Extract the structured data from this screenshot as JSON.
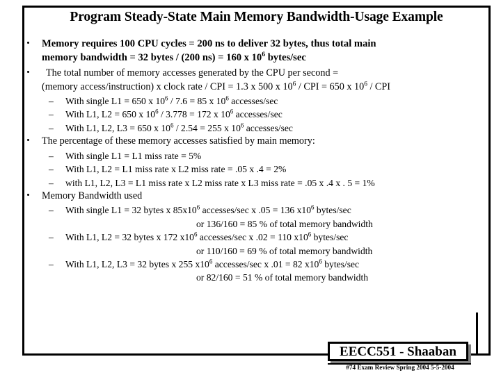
{
  "slide": {
    "title": "Program Steady-State Main Memory Bandwidth-Usage Example",
    "bullets": [
      {
        "id": "memory-requires",
        "line1": "Memory requires 100 CPU cycles =  200 ns  to deliver 32 bytes, thus total main",
        "line2_a": "memory bandwidth  =  32 bytes / (200 ns)   = 160 x 10",
        "line2_sup": "6",
        "line2_b": " bytes/sec"
      },
      {
        "id": "total-accesses",
        "line1": "The total number of memory accesses generated by the CPU per second  =",
        "line2_a": "(memory access/instruction)  x clock rate / CPI  =  1.3 x 500 x 10",
        "line2_sup1": "6",
        "line2_b": " / CPI =  650 x 10",
        "line2_sup2": "6",
        "line2_c": " / CPI",
        "subs": [
          {
            "a": "With single L1   = 650 x 10",
            "s1": "6",
            "b": " / 7.6   =   85 x   10",
            "s2": "6",
            "c": "  accesses/sec"
          },
          {
            "a": "With L1, L2   =   650 x 10",
            "s1": "6",
            "b": " / 3.778 =   172 x   10",
            "s2": "6",
            "c": "  accesses/sec"
          },
          {
            "a": "With L1, L2, L3  = 650 x 10",
            "s1": "6",
            "b": " / 2.54  =   255 x   10",
            "s2": "6",
            "c": "  accesses/sec"
          }
        ]
      },
      {
        "id": "percentage-satisfied",
        "line1": "The percentage of these memory accesses satisfied by main memory:",
        "subs": [
          {
            "a": "With single L1  =  L1 miss rate =  5%"
          },
          {
            "a": "With L1, L2  =  L1 miss rate x L2 miss rate =    .05 x .4  = 2%"
          },
          {
            "a": "with L1, L2, L3  = L1 miss rate x L2 miss rate  x L3 miss rate = .05 x .4 x . 5 = 1%"
          }
        ]
      },
      {
        "id": "bandwidth-used",
        "line1": "Memory Bandwidth used",
        "subs": [
          {
            "a": "With single L1 =  32 bytes  x  85x10",
            "s1": "6",
            "b": "  accesses/sec x .05  =   136 x10",
            "s2": "6",
            "c": "    bytes/sec",
            "cont": "or  136/160  =  85 %  of total memory bandwidth"
          },
          {
            "a": "With  L1, L2 =  32 bytes  x  172 x10",
            "s1": "6",
            "b": "  accesses/sec x .02  =   110 x10",
            "s2": "6",
            "c": "    bytes/sec",
            "cont": "or  110/160  =  69 %  of total memory bandwidth"
          },
          {
            "a": "With  L1, L2, L3  =  32 bytes  x  255 x10",
            "s1": "6",
            "b": "  accesses/sec x .01  =    82 x10",
            "s2": "6",
            "c": "   bytes/sec",
            "cont": "or  82/160  =  51 %  of total memory bandwidth"
          }
        ]
      }
    ],
    "dash_marker": "–",
    "footer": {
      "plate_text": "EECC551 - Shaaban",
      "footnote": "#74   Exam Review  Spring 2004  5-5-2004"
    }
  }
}
